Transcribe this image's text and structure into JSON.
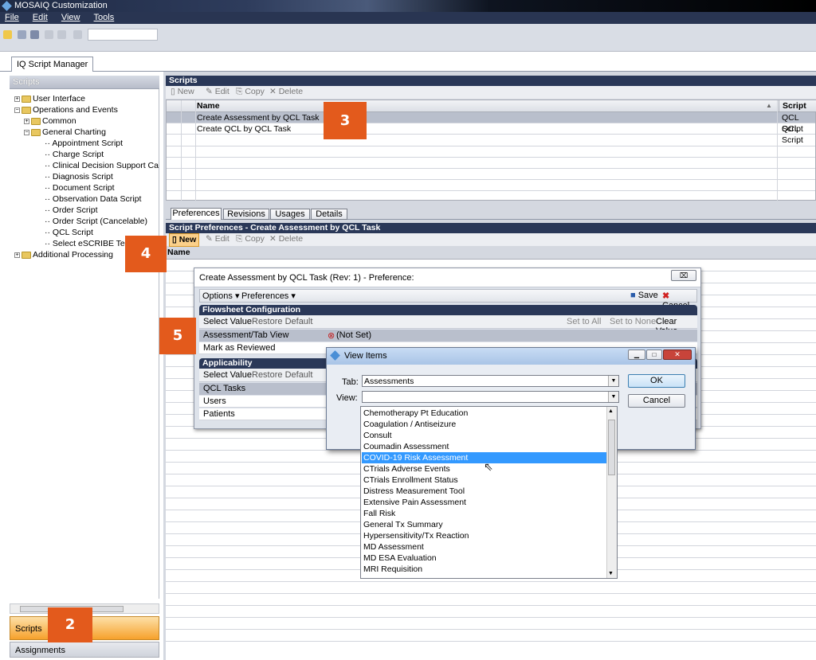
{
  "window": {
    "title": "MOSAIQ Customization"
  },
  "menu": [
    "File",
    "Edit",
    "View",
    "Tools"
  ],
  "main_tab": "IQ Script Manager",
  "left": {
    "header": "Scripts",
    "tree": [
      {
        "label": "User Interface",
        "type": "folder"
      },
      {
        "label": "Operations and Events",
        "type": "folder"
      },
      {
        "label": "Common",
        "type": "folder"
      },
      {
        "label": "General Charting",
        "type": "folder"
      },
      {
        "label": "Appointment Script",
        "type": "leaf"
      },
      {
        "label": "Charge Script",
        "type": "leaf"
      },
      {
        "label": "Clinical Decision Support Care",
        "type": "leaf"
      },
      {
        "label": "Diagnosis Script",
        "type": "leaf"
      },
      {
        "label": "Document Script",
        "type": "leaf"
      },
      {
        "label": "Observation Data Script",
        "type": "leaf"
      },
      {
        "label": "Order Script",
        "type": "leaf"
      },
      {
        "label": "Order Script (Cancelable)",
        "type": "leaf"
      },
      {
        "label": "QCL Script",
        "type": "leaf"
      },
      {
        "label": "Select eSCRIBE Tem",
        "type": "leaf"
      },
      {
        "label": "Additional Processing",
        "type": "folder"
      }
    ],
    "scripts_button": "Scripts",
    "assignments_button": "Assignments"
  },
  "scripts_panel": {
    "header": "Scripts",
    "toolbar": {
      "new": "New",
      "edit": "Edit",
      "copy": "Copy",
      "delete": "Delete"
    },
    "columns": {
      "name": "Name",
      "script_type": "Script Typ"
    },
    "rows": [
      {
        "name": "Create Assessment by QCL Task",
        "type": "QCL Script"
      },
      {
        "name": "Create QCL by QCL Task",
        "type": "QCL Script"
      }
    ]
  },
  "lower_tabs": [
    "Preferences",
    "Revisions",
    "Usages",
    "Details"
  ],
  "prefs_panel": {
    "header": "Script Preferences - Create Assessment by QCL Task",
    "toolbar": {
      "new": "New",
      "edit": "Edit",
      "copy": "Copy",
      "delete": "Delete"
    },
    "column": "Name"
  },
  "pref_dialog": {
    "title": "Create Assessment by QCL Task (Rev: 1) - Preference:",
    "close": "⌧",
    "options_menu": "Options ▾",
    "preferences_menu": "Preferences ▾",
    "save": "Save",
    "cancel": "Cancel",
    "flowsheet_header": "Flowsheet Configuration",
    "select_value": "Select Value",
    "restore_default": "Restore Default",
    "set_to_all": "Set to All",
    "set_to_none": "Set to None",
    "clear_value": "Clear Value",
    "rows": [
      {
        "label": "Assessment/Tab View",
        "value": "(Not Set)"
      },
      {
        "label": "Mark as Reviewed",
        "value": ""
      }
    ],
    "applicability_header": "Applicability",
    "app_select_value": "Select Value",
    "app_restore_default": "Restore Default",
    "app_rows": [
      "QCL Tasks",
      "Users",
      "Patients"
    ]
  },
  "view_items": {
    "title": "View Items",
    "tab_label": "Tab:",
    "tab_value": "Assessments",
    "view_label": "View:",
    "view_value": "",
    "ok": "OK",
    "cancel": "Cancel",
    "options": [
      "Chemotherapy Pt Education",
      "Coagulation / Antiseizure",
      "Consult",
      "Coumadin Assessment",
      "COVID-19 Risk Assessment",
      "CTrials Adverse Events",
      "CTrials Enrollment Status",
      "Distress Measurement Tool",
      "Extensive Pain Assessment",
      "Fall Risk",
      "General Tx Summary",
      "Hypersensitivity/Tx Reaction",
      "MD Assessment",
      "MD ESA Evaluation",
      "MRI Requisition"
    ],
    "selected_index": 4
  },
  "callouts": [
    "2",
    "3",
    "4",
    "5"
  ],
  "colors": {
    "callout": "#e35a1c",
    "dark_header": "#2a3858",
    "selection": "#3399ff"
  }
}
